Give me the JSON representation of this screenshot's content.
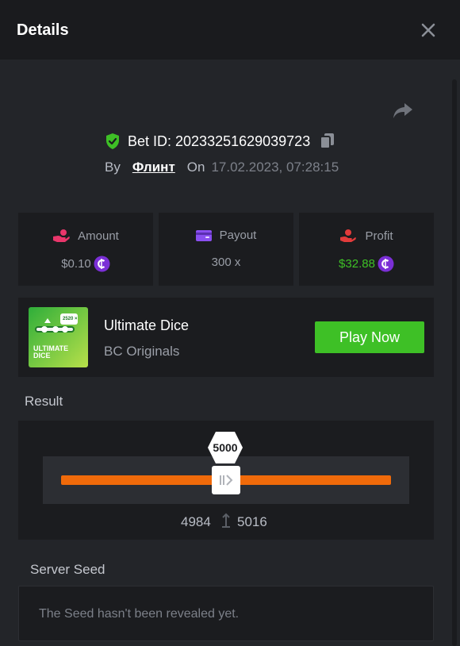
{
  "header": {
    "title": "Details"
  },
  "bet": {
    "id_text": "Bet ID: 20233251629039723",
    "by_label": "By",
    "user": "Флинт",
    "on_label": "On",
    "date": "17.02.2023, 07:28:15"
  },
  "stats": [
    {
      "label": "Amount",
      "value": "$0.10",
      "icon": "hand-coins-icon"
    },
    {
      "label": "Payout",
      "value": "300 x",
      "icon": "wallet-icon"
    },
    {
      "label": "Profit",
      "value": "$32.88",
      "icon": "hand-money-icon"
    }
  ],
  "game": {
    "name": "Ultimate Dice",
    "provider": "BC Originals",
    "play_label": "Play Now",
    "thumb_text": "ULTIMATE DICE",
    "thumb_badge": "2520 ×"
  },
  "result": {
    "label": "Result",
    "value": "5000",
    "range_low": "4984",
    "range_high": "5016"
  },
  "seed": {
    "label": "Server Seed",
    "text": "The Seed hasn't been revealed yet."
  },
  "colors": {
    "accent_green": "#3ec026",
    "track_orange": "#f06a0a",
    "coin_purple": "#7b2fd6",
    "amount_pink": "#e9366b",
    "payout_purple": "#8a4ff0",
    "profit_red": "#e23b3b"
  }
}
